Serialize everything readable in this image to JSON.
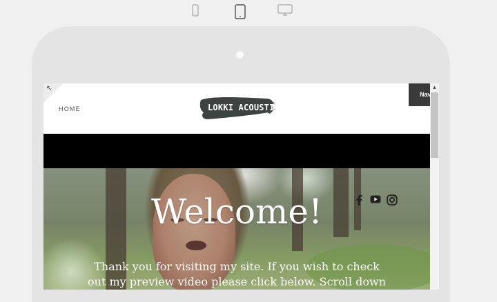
{
  "device_switcher": {
    "icons": [
      "mobile-icon",
      "tablet-icon",
      "desktop-icon"
    ],
    "selected": "tablet"
  },
  "site": {
    "corner_icon": "expand-arrow-icon",
    "nav_home": "HOME",
    "logo_text": "LOKKI ACOUSTIC",
    "nav_tab": "Nav",
    "welcome": "Welcome!",
    "intro": "Thank you for visiting my site. If you wish to check out my preview video please click below. Scroll down for",
    "social_icons": [
      "facebook-icon",
      "youtube-icon",
      "instagram-icon"
    ]
  },
  "colors": {
    "tab_bg": "#3a3a3a",
    "logo_brush": "#3d4340",
    "background": "#f0f0f0"
  }
}
